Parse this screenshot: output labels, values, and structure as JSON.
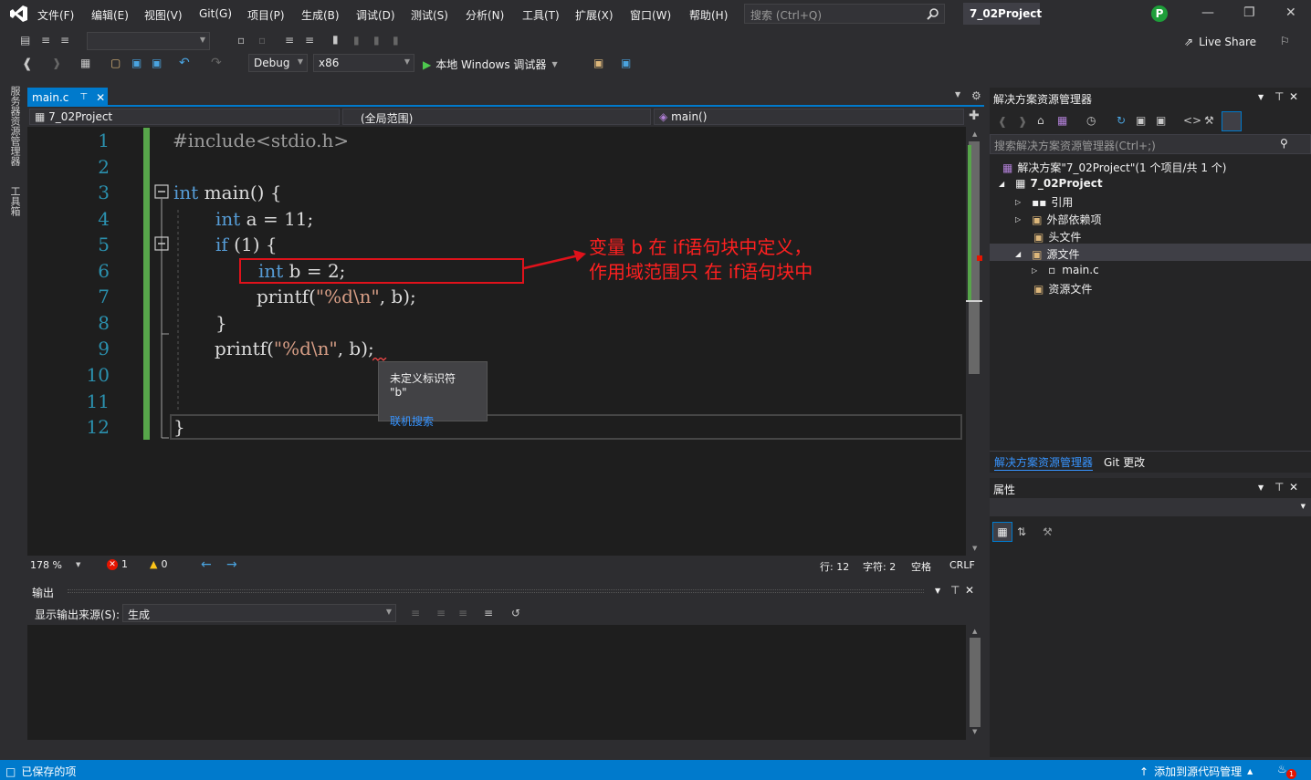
{
  "menu": [
    "文件(F)",
    "编辑(E)",
    "视图(V)",
    "Git(G)",
    "项目(P)",
    "生成(B)",
    "调试(D)",
    "测试(S)",
    "分析(N)",
    "工具(T)",
    "扩展(X)",
    "窗口(W)",
    "帮助(H)"
  ],
  "search": {
    "placeholder": "搜索 (Ctrl+Q)"
  },
  "project_title": "7_02Project",
  "avatar_letter": "P",
  "live_share": "Live Share",
  "toolbar": {
    "config": "Debug",
    "platform": "x86",
    "run_label": "本地 Windows 调试器"
  },
  "left_strip": [
    "服务器资源管理器",
    "工具箱"
  ],
  "editor": {
    "tab_label": "main.c",
    "nav_project": "7_02Project",
    "nav_scope": "(全局范围)",
    "nav_func": "main()",
    "line_numbers": [
      "1",
      "2",
      "3",
      "4",
      "5",
      "6",
      "7",
      "8",
      "9",
      "10",
      "11",
      "12"
    ],
    "annotation": [
      "变量 b 在 if语句块中定义，",
      "作用域范围只 在 if语句块中"
    ],
    "tooltip": {
      "message": "未定义标识符 \"b\"",
      "link": "联机搜索"
    }
  },
  "status_line": {
    "zoom": "178 %",
    "errors": "1",
    "warnings": "0",
    "row": "行: 12",
    "col": "字符: 2",
    "spaces": "空格",
    "eol": "CRLF"
  },
  "output": {
    "title": "输出",
    "source_label": "显示输出来源(S):",
    "source_value": "生成"
  },
  "solution_explorer": {
    "title": "解决方案资源管理器",
    "search_placeholder": "搜索解决方案资源管理器(Ctrl+;)",
    "solution": "解决方案\"7_02Project\"(1 个项目/共 1 个)",
    "project": "7_02Project",
    "items": [
      "引用",
      "外部依赖项",
      "头文件",
      "源文件",
      "main.c",
      "资源文件"
    ],
    "bottom_tabs": [
      "解决方案资源管理器",
      "Git 更改"
    ]
  },
  "properties": {
    "title": "属性"
  },
  "statusbar": {
    "left": "已保存的项",
    "right": "添加到源代码管理",
    "badge": "1"
  },
  "colors": {
    "accent": "#007acc",
    "annotation": "#ff2020",
    "line_numbers": "#2b91af",
    "keyword": "#569cd6"
  }
}
